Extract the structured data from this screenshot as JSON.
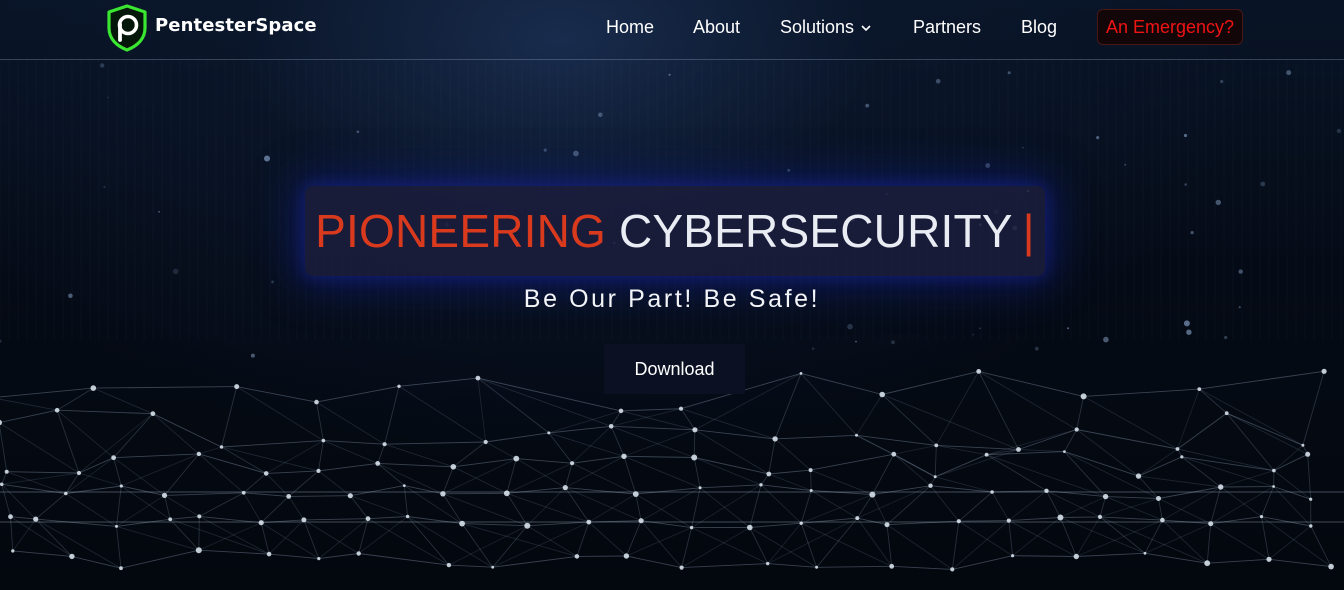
{
  "brand": {
    "name": "PentesterSpace",
    "logo_icon": "shield-p-logo-icon",
    "logo_letter": "P",
    "accent_color": "#3be632"
  },
  "nav": {
    "items": [
      {
        "label": "Home"
      },
      {
        "label": "About"
      },
      {
        "label": "Solutions",
        "icon": "chevron-down-icon"
      },
      {
        "label": "Partners"
      },
      {
        "label": "Blog"
      }
    ],
    "emergency_label": "An Emergency?",
    "emergency_color": "#ef1414"
  },
  "hero": {
    "headline_accent": "PIONEERING",
    "headline_main": "CYBERSECURITY",
    "headline_cursor": "|",
    "accent_color": "#d93a1e",
    "tagline": "Be Our Part! Be Safe!",
    "download_label": "Download",
    "background": "network-mesh-background"
  }
}
